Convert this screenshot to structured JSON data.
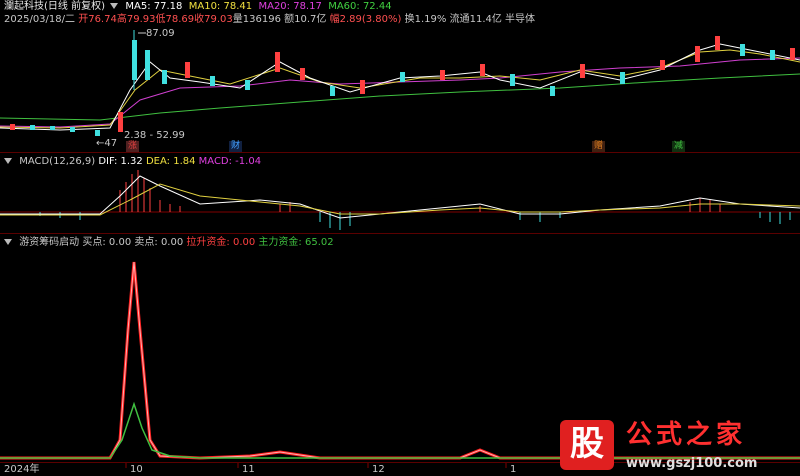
{
  "header": {
    "title": "瀾起科技(日线 前复权)",
    "ma": [
      {
        "label": "MA5: 77.18",
        "color": "#ffffff"
      },
      {
        "label": "MA10: 78.41",
        "color": "#f0e040"
      },
      {
        "label": "MA20: 78.17",
        "color": "#e040e0"
      },
      {
        "label": "MA60: 72.44",
        "color": "#40d040"
      }
    ]
  },
  "quote": {
    "date": "2025/03/18/二",
    "open": "开76.74",
    "high": "高79.93",
    "low": "低78.69",
    "close": "收79.03",
    "vol": "量136196",
    "amount": "额10.7亿",
    "change": "幅2.89(3.80%)",
    "turnover": "换1.19%",
    "float": "流通11.4亿",
    "sector": "半导体"
  },
  "price_annotations": {
    "high": "87.09",
    "low": "47",
    "range": "2.38 - 52.99"
  },
  "event_tags": [
    {
      "text": "涨",
      "color": "#e04040",
      "bg": "#502020"
    },
    {
      "text": "财",
      "color": "#40a0ff",
      "bg": "#102040"
    },
    {
      "text": "赠",
      "color": "#e08020",
      "bg": "#402010"
    },
    {
      "text": "减",
      "color": "#40c040",
      "bg": "#103010"
    }
  ],
  "macd": {
    "label": "MACD(12,26,9)",
    "dif": "DIF: 1.32",
    "dea": "DEA: 1.84",
    "macd": "MACD: -1.04"
  },
  "indicator": {
    "name": "游资筹码启动",
    "buy": "买点: 0.00",
    "sell": "卖点: 0.00",
    "lift": "拉升资金: 0.00",
    "main": "主力资金: 65.02"
  },
  "axis": {
    "labels": [
      "2024年",
      "10",
      "11",
      "12",
      "1"
    ]
  },
  "watermark": {
    "logo": "股",
    "text": "公式之家",
    "url": "www.gszj100.com"
  }
}
